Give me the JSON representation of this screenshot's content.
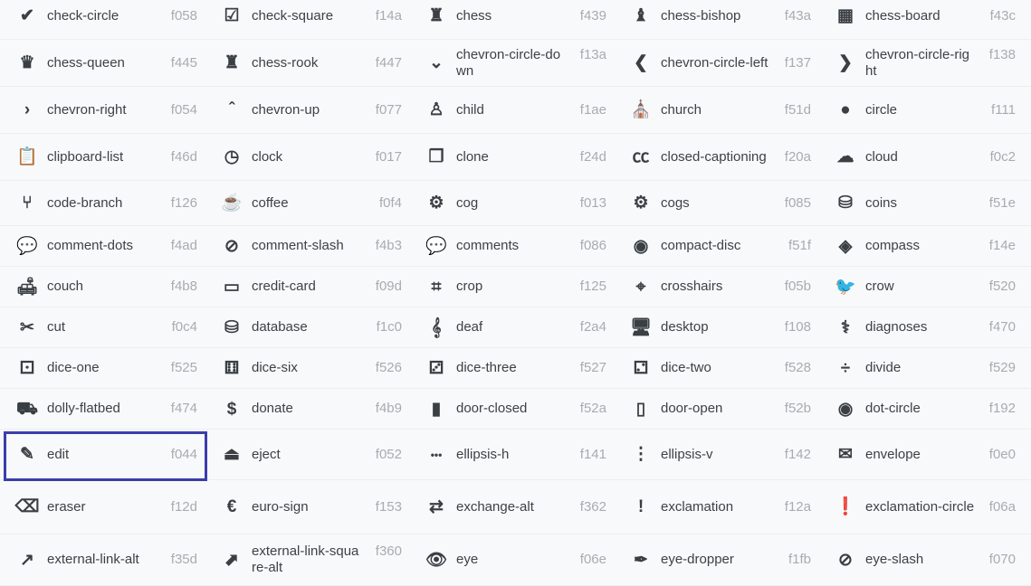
{
  "selected": "edit",
  "accent_color": "#3a3eaa",
  "rows": [
    [
      {
        "name": "check-circle",
        "code": "f058",
        "icon": "✔"
      },
      {
        "name": "check-square",
        "code": "f14a",
        "icon": "☑"
      },
      {
        "name": "chess",
        "code": "f439",
        "icon": "♜"
      },
      {
        "name": "chess-bishop",
        "code": "f43a",
        "icon": "♝"
      },
      {
        "name": "chess-board",
        "code": "f43c",
        "icon": "▦"
      }
    ],
    [
      {
        "name": "chess-queen",
        "code": "f445",
        "icon": "♛"
      },
      {
        "name": "chess-rook",
        "code": "f447",
        "icon": "♜"
      },
      {
        "name": "chevron-circle-down",
        "code": "f13a",
        "icon": "⌄"
      },
      {
        "name": "chevron-circle-left",
        "code": "f137",
        "icon": "❮"
      },
      {
        "name": "chevron-circle-right",
        "code": "f138",
        "icon": "❯"
      }
    ],
    [
      {
        "name": "chevron-right",
        "code": "f054",
        "icon": "›"
      },
      {
        "name": "chevron-up",
        "code": "f077",
        "icon": "ˆ"
      },
      {
        "name": "child",
        "code": "f1ae",
        "icon": "♙"
      },
      {
        "name": "church",
        "code": "f51d",
        "icon": "⛪"
      },
      {
        "name": "circle",
        "code": "f111",
        "icon": "●"
      }
    ],
    [
      {
        "name": "clipboard-list",
        "code": "f46d",
        "icon": "📋"
      },
      {
        "name": "clock",
        "code": "f017",
        "icon": "◷"
      },
      {
        "name": "clone",
        "code": "f24d",
        "icon": "❐"
      },
      {
        "name": "closed-captioning",
        "code": "f20a",
        "icon": "㏄"
      },
      {
        "name": "cloud",
        "code": "f0c2",
        "icon": "☁"
      }
    ],
    [
      {
        "name": "code-branch",
        "code": "f126",
        "icon": "⑂"
      },
      {
        "name": "coffee",
        "code": "f0f4",
        "icon": "☕"
      },
      {
        "name": "cog",
        "code": "f013",
        "icon": "⚙"
      },
      {
        "name": "cogs",
        "code": "f085",
        "icon": "⚙"
      },
      {
        "name": "coins",
        "code": "f51e",
        "icon": "⛁"
      }
    ],
    [
      {
        "name": "comment-dots",
        "code": "f4ad",
        "icon": "💬"
      },
      {
        "name": "comment-slash",
        "code": "f4b3",
        "icon": "⊘"
      },
      {
        "name": "comments",
        "code": "f086",
        "icon": "💬"
      },
      {
        "name": "compact-disc",
        "code": "f51f",
        "icon": "◉"
      },
      {
        "name": "compass",
        "code": "f14e",
        "icon": "◈"
      }
    ],
    [
      {
        "name": "couch",
        "code": "f4b8",
        "icon": "🛋"
      },
      {
        "name": "credit-card",
        "code": "f09d",
        "icon": "▭"
      },
      {
        "name": "crop",
        "code": "f125",
        "icon": "⌗"
      },
      {
        "name": "crosshairs",
        "code": "f05b",
        "icon": "⌖"
      },
      {
        "name": "crow",
        "code": "f520",
        "icon": "🐦"
      }
    ],
    [
      {
        "name": "cut",
        "code": "f0c4",
        "icon": "✂"
      },
      {
        "name": "database",
        "code": "f1c0",
        "icon": "⛁"
      },
      {
        "name": "deaf",
        "code": "f2a4",
        "icon": "𝄞"
      },
      {
        "name": "desktop",
        "code": "f108",
        "icon": "🖥"
      },
      {
        "name": "diagnoses",
        "code": "f470",
        "icon": "⚕"
      }
    ],
    [
      {
        "name": "dice-one",
        "code": "f525",
        "icon": "⚀"
      },
      {
        "name": "dice-six",
        "code": "f526",
        "icon": "⚅"
      },
      {
        "name": "dice-three",
        "code": "f527",
        "icon": "⚂"
      },
      {
        "name": "dice-two",
        "code": "f528",
        "icon": "⚁"
      },
      {
        "name": "divide",
        "code": "f529",
        "icon": "÷"
      }
    ],
    [
      {
        "name": "dolly-flatbed",
        "code": "f474",
        "icon": "⛟"
      },
      {
        "name": "donate",
        "code": "f4b9",
        "icon": "$"
      },
      {
        "name": "door-closed",
        "code": "f52a",
        "icon": "▮"
      },
      {
        "name": "door-open",
        "code": "f52b",
        "icon": "▯"
      },
      {
        "name": "dot-circle",
        "code": "f192",
        "icon": "◉"
      }
    ],
    [
      {
        "name": "edit",
        "code": "f044",
        "icon": "✎"
      },
      {
        "name": "eject",
        "code": "f052",
        "icon": "⏏"
      },
      {
        "name": "ellipsis-h",
        "code": "f141",
        "icon": "•••"
      },
      {
        "name": "ellipsis-v",
        "code": "f142",
        "icon": "⋮"
      },
      {
        "name": "envelope",
        "code": "f0e0",
        "icon": "✉"
      }
    ],
    [
      {
        "name": "eraser",
        "code": "f12d",
        "icon": "⌫"
      },
      {
        "name": "euro-sign",
        "code": "f153",
        "icon": "€"
      },
      {
        "name": "exchange-alt",
        "code": "f362",
        "icon": "⇄"
      },
      {
        "name": "exclamation",
        "code": "f12a",
        "icon": "!"
      },
      {
        "name": "exclamation-circle",
        "code": "f06a",
        "icon": "❗"
      }
    ],
    [
      {
        "name": "external-link-alt",
        "code": "f35d",
        "icon": "↗"
      },
      {
        "name": "external-link-square-alt",
        "code": "f360",
        "icon": "⬈"
      },
      {
        "name": "eye",
        "code": "f06e",
        "icon": "👁"
      },
      {
        "name": "eye-dropper",
        "code": "f1fb",
        "icon": "✒"
      },
      {
        "name": "eye-slash",
        "code": "f070",
        "icon": "⊘"
      }
    ]
  ]
}
